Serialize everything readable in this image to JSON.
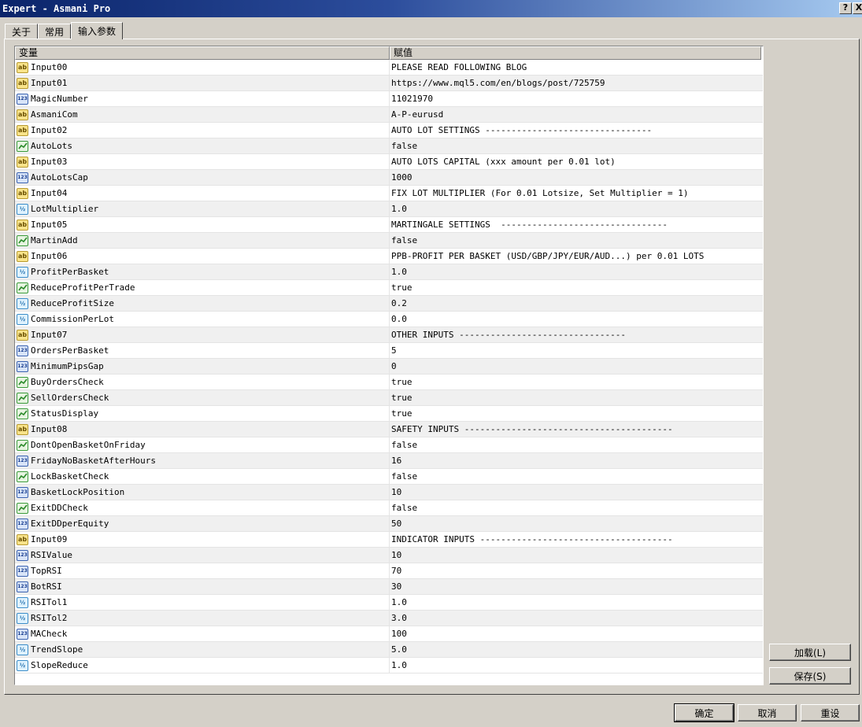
{
  "window": {
    "title": "Expert - Asmani Pro",
    "help_btn": "?",
    "close_btn": "X"
  },
  "tabs": [
    {
      "label": "关于"
    },
    {
      "label": "常用"
    },
    {
      "label": "输入参数"
    }
  ],
  "grid": {
    "headers": {
      "name": "变量",
      "value": "赋值"
    },
    "rows": [
      {
        "type": "string",
        "name": "Input00",
        "value": "PLEASE READ FOLLOWING BLOG"
      },
      {
        "type": "string",
        "name": "Input01",
        "value": "https://www.mql5.com/en/blogs/post/725759"
      },
      {
        "type": "int",
        "name": "MagicNumber",
        "value": "11021970"
      },
      {
        "type": "string",
        "name": "AsmaniCom",
        "value": "A-P-eurusd"
      },
      {
        "type": "string",
        "name": "Input02",
        "value": "AUTO LOT SETTINGS --------------------------------"
      },
      {
        "type": "bool",
        "name": "AutoLots",
        "value": "false"
      },
      {
        "type": "string",
        "name": "Input03",
        "value": "AUTO LOTS CAPITAL (xxx amount per 0.01 lot)"
      },
      {
        "type": "int",
        "name": "AutoLotsCap",
        "value": "1000"
      },
      {
        "type": "string",
        "name": "Input04",
        "value": "FIX LOT MULTIPLIER (For 0.01 Lotsize, Set Multiplier = 1)"
      },
      {
        "type": "double",
        "name": "LotMultiplier",
        "value": "1.0"
      },
      {
        "type": "string",
        "name": "Input05",
        "value": "MARTINGALE SETTINGS  --------------------------------"
      },
      {
        "type": "bool",
        "name": "MartinAdd",
        "value": "false"
      },
      {
        "type": "string",
        "name": "Input06",
        "value": "PPB-PROFIT PER BASKET (USD/GBP/JPY/EUR/AUD...) per 0.01 LOTS"
      },
      {
        "type": "double",
        "name": "ProfitPerBasket",
        "value": "1.0"
      },
      {
        "type": "bool",
        "name": "ReduceProfitPerTrade",
        "value": "true"
      },
      {
        "type": "double",
        "name": "ReduceProfitSize",
        "value": "0.2"
      },
      {
        "type": "double",
        "name": "CommissionPerLot",
        "value": "0.0"
      },
      {
        "type": "string",
        "name": "Input07",
        "value": "OTHER INPUTS --------------------------------"
      },
      {
        "type": "int",
        "name": "OrdersPerBasket",
        "value": "5"
      },
      {
        "type": "int",
        "name": "MinimumPipsGap",
        "value": "0"
      },
      {
        "type": "bool",
        "name": "BuyOrdersCheck",
        "value": "true"
      },
      {
        "type": "bool",
        "name": "SellOrdersCheck",
        "value": "true"
      },
      {
        "type": "bool",
        "name": "StatusDisplay",
        "value": "true"
      },
      {
        "type": "string",
        "name": "Input08",
        "value": "SAFETY INPUTS ----------------------------------------"
      },
      {
        "type": "bool",
        "name": "DontOpenBasketOnFriday",
        "value": "false"
      },
      {
        "type": "int",
        "name": "FridayNoBasketAfterHours",
        "value": "16"
      },
      {
        "type": "bool",
        "name": "LockBasketCheck",
        "value": "false"
      },
      {
        "type": "int",
        "name": "BasketLockPosition",
        "value": "10"
      },
      {
        "type": "bool",
        "name": "ExitDDCheck",
        "value": "false"
      },
      {
        "type": "int",
        "name": "ExitDDperEquity",
        "value": "50"
      },
      {
        "type": "string",
        "name": "Input09",
        "value": "INDICATOR INPUTS -------------------------------------"
      },
      {
        "type": "int",
        "name": "RSIValue",
        "value": "10"
      },
      {
        "type": "int",
        "name": "TopRSI",
        "value": "70"
      },
      {
        "type": "int",
        "name": "BotRSI",
        "value": "30"
      },
      {
        "type": "double",
        "name": "RSITol1",
        "value": "1.0"
      },
      {
        "type": "double",
        "name": "RSITol2",
        "value": "3.0"
      },
      {
        "type": "int",
        "name": "MACheck",
        "value": "100"
      },
      {
        "type": "double",
        "name": "TrendSlope",
        "value": "5.0"
      },
      {
        "type": "double",
        "name": "SlopeReduce",
        "value": "1.0"
      }
    ]
  },
  "icons": {
    "string": "ab",
    "int": "123",
    "double": "½",
    "bool": "bool-graph-icon"
  },
  "buttons": {
    "load": "加载(L)",
    "save": "保存(S)",
    "ok": "确定",
    "cancel": "取消",
    "reset": "重设"
  }
}
